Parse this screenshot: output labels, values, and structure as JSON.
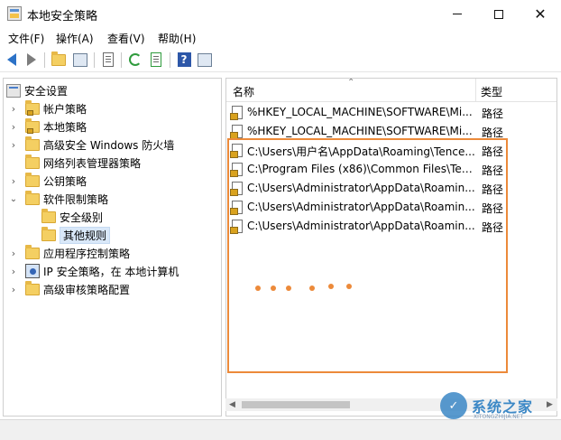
{
  "window": {
    "title": "本地安全策略"
  },
  "menu": [
    "文件(F)",
    "操作(A)",
    "查看(V)",
    "帮助(H)"
  ],
  "tree": [
    {
      "label": "安全设置",
      "icon": "security-settings-icon",
      "expander": "none",
      "indent": 0
    },
    {
      "label": "帐户策略",
      "icon": "locked-folder-icon",
      "expander": "collapsed",
      "indent": 1
    },
    {
      "label": "本地策略",
      "icon": "locked-folder-icon",
      "expander": "collapsed",
      "indent": 1
    },
    {
      "label": "高级安全 Windows 防火墙",
      "icon": "folder-icon",
      "expander": "collapsed",
      "indent": 1
    },
    {
      "label": "网络列表管理器策略",
      "icon": "folder-icon",
      "expander": "none",
      "indent": 1
    },
    {
      "label": "公钥策略",
      "icon": "folder-icon",
      "expander": "collapsed",
      "indent": 1
    },
    {
      "label": "软件限制策略",
      "icon": "folder-icon",
      "expander": "expanded",
      "indent": 1
    },
    {
      "label": "安全级别",
      "icon": "folder-icon",
      "expander": "none",
      "indent": 2
    },
    {
      "label": "其他规则",
      "icon": "folder-icon",
      "expander": "none",
      "indent": 2,
      "selected": true
    },
    {
      "label": "应用程序控制策略",
      "icon": "folder-icon",
      "expander": "collapsed",
      "indent": 1
    },
    {
      "label": "IP 安全策略，在 本地计算机",
      "icon": "ip-security-icon",
      "expander": "collapsed",
      "indent": 1
    },
    {
      "label": "高级审核策略配置",
      "icon": "folder-icon",
      "expander": "collapsed",
      "indent": 1
    }
  ],
  "list": {
    "columns": {
      "name": "名称",
      "type": "类型"
    },
    "rows": [
      {
        "name": "%HKEY_LOCAL_MACHINE\\SOFTWARE\\Mi...",
        "type": "路径"
      },
      {
        "name": "%HKEY_LOCAL_MACHINE\\SOFTWARE\\Mi...",
        "type": "路径"
      },
      {
        "name": "C:\\Users\\用户名\\AppData\\Roaming\\Tence...",
        "type": "路径"
      },
      {
        "name": "C:\\Program Files (x86)\\Common Files\\Ten...",
        "type": "路径"
      },
      {
        "name": "C:\\Users\\Administrator\\AppData\\Roamin...",
        "type": "路径"
      },
      {
        "name": "C:\\Users\\Administrator\\AppData\\Roamin...",
        "type": "路径"
      },
      {
        "name": "C:\\Users\\Administrator\\AppData\\Roamin...",
        "type": "路径"
      }
    ]
  },
  "annotation": {
    "color": "#ec8a3a",
    "dots": 6
  },
  "watermark": {
    "text": "系统之家",
    "sub": "XITONGZHIJIA.NET"
  }
}
